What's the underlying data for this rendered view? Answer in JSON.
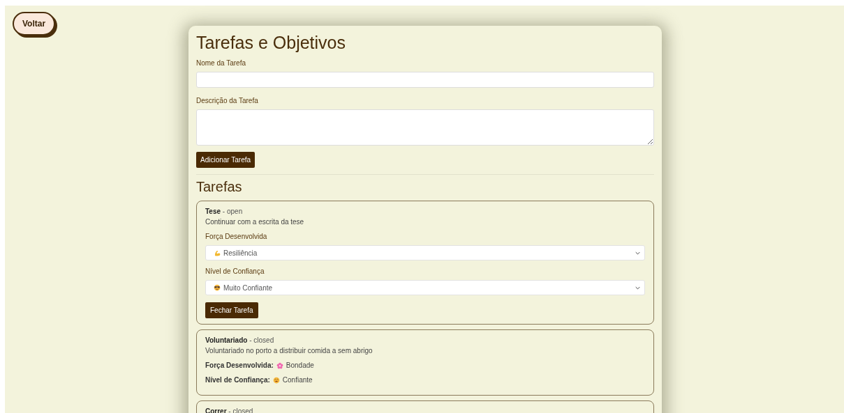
{
  "back_button": "Voltar",
  "title": "Tarefas e Objetivos",
  "form": {
    "name_label": "Nome da Tarefa",
    "description_label": "Descrição da Tarefa",
    "submit": "Adicionar Tarefa"
  },
  "tasks_heading": "Tarefas",
  "tasks": [
    {
      "kind": "open",
      "name": "Tese",
      "separator": "-",
      "status": "open",
      "description": "Continuar com a escrita da tese",
      "strength_label": "Força Desenvolvida",
      "strength": {
        "kind": "arm",
        "text": "Resiliência"
      },
      "confidence_label": "Nível de Confiança",
      "confidence": {
        "kind": "sunglasses",
        "text": "Muito Confiante"
      },
      "close_button": "Fechar Tarefa"
    },
    {
      "kind": "closed",
      "name": "Voluntariado",
      "separator": "-",
      "status": "closed",
      "description": "Voluntariado no porto a distribuir comida a sem abrigo",
      "strength_label": "Força Desenvolvida:",
      "strength": {
        "kind": "flower",
        "text": "Bondade"
      },
      "confidence_label": "Nível de Confiança:",
      "confidence": {
        "kind": "smile",
        "text": "Confiante"
      }
    },
    {
      "kind": "closed",
      "name": "Correr",
      "separator": "-",
      "status": "closed"
    }
  ]
}
